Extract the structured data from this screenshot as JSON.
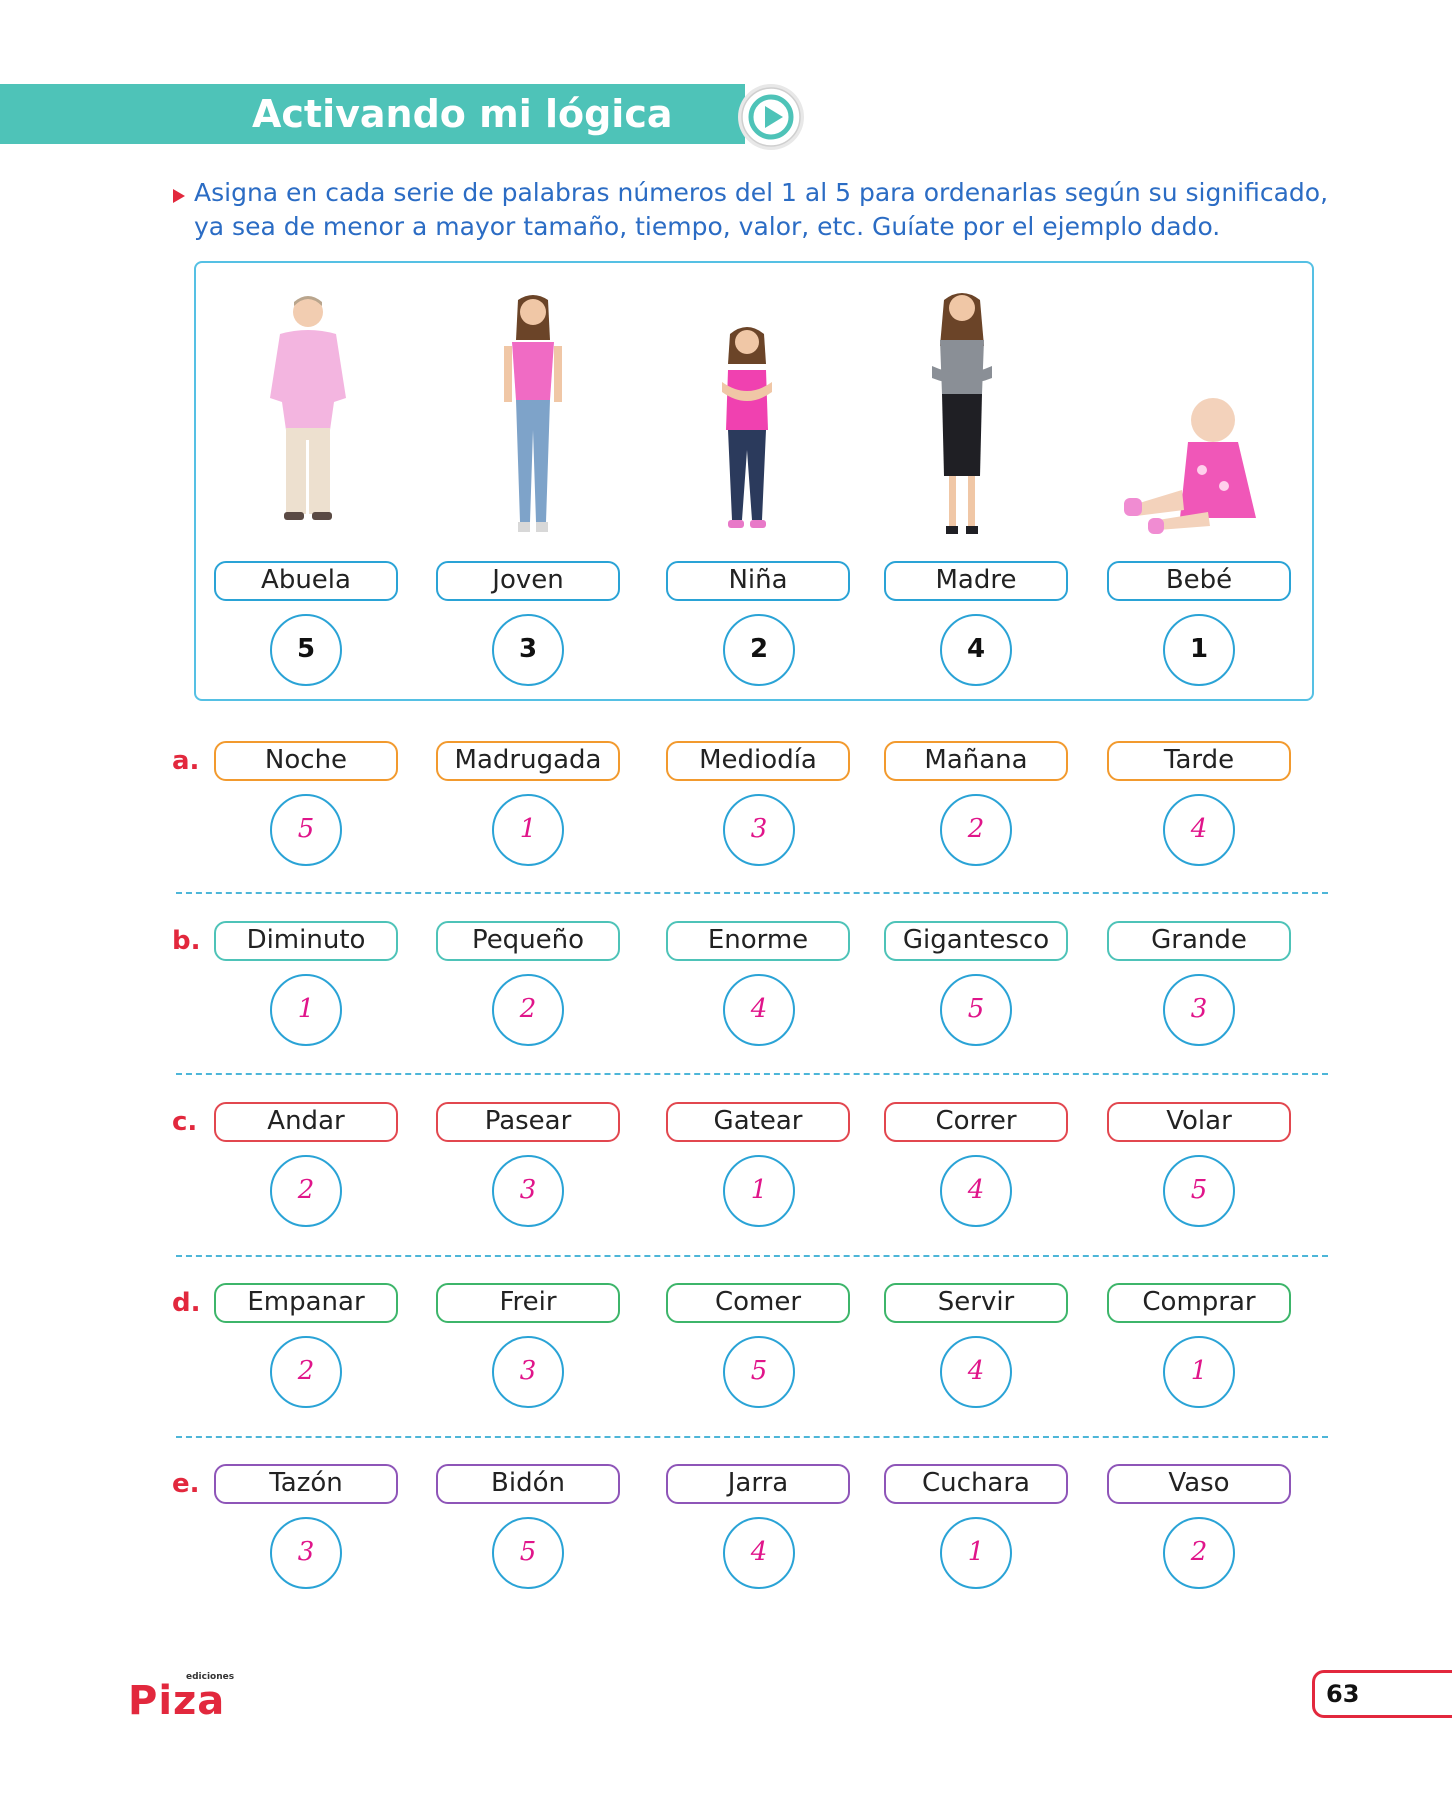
{
  "header": {
    "title": "Activando mi lógica"
  },
  "instruction": {
    "lines": [
      "Asigna en cada serie de palabras números del 1 al 5 para ordenarlas según su significado,",
      "ya sea de menor a mayor tamaño, tiempo, valor, etc. Guíate por el ejemplo dado."
    ]
  },
  "example": {
    "words": [
      "Abuela",
      "Joven",
      "Niña",
      "Madre",
      "Bebé"
    ],
    "numbers": [
      "5",
      "3",
      "2",
      "4",
      "1"
    ]
  },
  "exercises": [
    {
      "letter": "a.",
      "color": "#f29a2e",
      "words": [
        "Noche",
        "Madrugada",
        "Mediodía",
        "Mañana",
        "Tarde"
      ],
      "answers": [
        "5",
        "1",
        "3",
        "2",
        "4"
      ]
    },
    {
      "letter": "b.",
      "color": "#4ec3b8",
      "words": [
        "Diminuto",
        "Pequeño",
        "Enorme",
        "Gigantesco",
        "Grande"
      ],
      "answers": [
        "1",
        "2",
        "4",
        "5",
        "3"
      ]
    },
    {
      "letter": "c.",
      "color": "#e2474f",
      "words": [
        "Andar",
        "Pasear",
        "Gatear",
        "Correr",
        "Volar"
      ],
      "answers": [
        "2",
        "3",
        "1",
        "4",
        "5"
      ]
    },
    {
      "letter": "d.",
      "color": "#3db56a",
      "words": [
        "Empanar",
        "Freir",
        "Comer",
        "Servir",
        "Comprar"
      ],
      "answers": [
        "2",
        "3",
        "5",
        "4",
        "1"
      ]
    },
    {
      "letter": "e.",
      "color": "#8e55b8",
      "words": [
        "Tazón",
        "Bidón",
        "Jarra",
        "Cuchara",
        "Vaso"
      ],
      "answers": [
        "3",
        "5",
        "4",
        "1",
        "2"
      ]
    }
  ],
  "footer": {
    "brand_small": "ediciones",
    "brand": "Piza",
    "page_number": "63"
  },
  "colors": {
    "banner": "#4ec3b8",
    "circle_border": "#2aa3d6",
    "answer_text": "#e0158a",
    "accent_red": "#e2283d",
    "instruction_text": "#2b6cc4"
  }
}
